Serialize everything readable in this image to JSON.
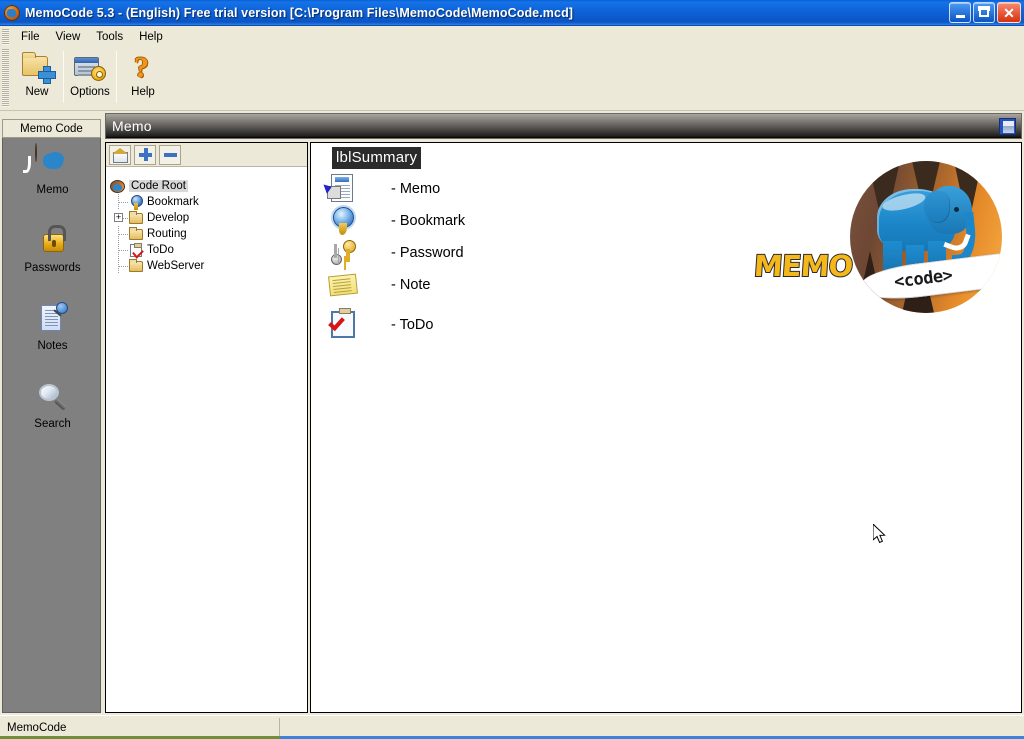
{
  "window": {
    "title": "MemoCode 5.3 - (English) Free trial version  [C:\\Program Files\\MemoCode\\MemoCode.mcd]",
    "app_icon": "memocode-elephant-icon",
    "controls": {
      "minimize": "minimize-button",
      "restore": "restore-button",
      "close": "close-button",
      "close_glyph": "✕"
    }
  },
  "menubar": {
    "items": [
      {
        "label": "File"
      },
      {
        "label": "View"
      },
      {
        "label": "Tools"
      },
      {
        "label": "Help"
      }
    ]
  },
  "toolbar": {
    "buttons": [
      {
        "label": "New",
        "icon": "new-folder-icon"
      },
      {
        "label": "Options",
        "icon": "options-gear-icon"
      },
      {
        "label": "Help",
        "icon": "help-question-icon"
      }
    ]
  },
  "sidebar": {
    "header": "Memo Code",
    "items": [
      {
        "label": "Memo",
        "icon": "memo-elephant-icon"
      },
      {
        "label": "Passwords",
        "icon": "padlock-icon"
      },
      {
        "label": "Notes",
        "icon": "note-pin-icon"
      },
      {
        "label": "Search",
        "icon": "magnifier-icon"
      }
    ]
  },
  "pane": {
    "title": "Memo",
    "save_icon": "save-disk-icon"
  },
  "tree": {
    "toolbar": [
      {
        "name": "home",
        "icon": "home-icon"
      },
      {
        "name": "expand-all",
        "icon": "plus-icon"
      },
      {
        "name": "collapse-all",
        "icon": "minus-icon"
      }
    ],
    "nodes": [
      {
        "label": "Code Root",
        "icon": "code-root-icon",
        "level": 0,
        "selected": true,
        "expander": ""
      },
      {
        "label": "Bookmark",
        "icon": "bookmark-icon",
        "level": 1,
        "selected": false,
        "expander": ""
      },
      {
        "label": "Develop",
        "icon": "folder-icon",
        "level": 1,
        "selected": false,
        "expander": "+"
      },
      {
        "label": "Routing",
        "icon": "folder-icon",
        "level": 1,
        "selected": false,
        "expander": ""
      },
      {
        "label": "ToDo",
        "icon": "todo-clipboard-icon",
        "level": 1,
        "selected": false,
        "expander": ""
      },
      {
        "label": "WebServer",
        "icon": "folder-icon",
        "level": 1,
        "selected": false,
        "expander": ""
      }
    ]
  },
  "content": {
    "summary_label": "lblSummary",
    "items": [
      {
        "text": "- Memo",
        "icon": "memo-document-icon"
      },
      {
        "text": "- Bookmark",
        "icon": "bookmark-rosette-icon"
      },
      {
        "text": "- Password",
        "icon": "keys-icon"
      },
      {
        "text": "- Note",
        "icon": "sticky-note-icon"
      },
      {
        "text": "- ToDo",
        "icon": "todo-clipboard-icon"
      }
    ],
    "logo": {
      "wordmark": "MEMO",
      "ribbon_text": "<code>",
      "alt": "memocode-elephant-logo"
    }
  },
  "statusbar": {
    "text": "MemoCode"
  },
  "colors": {
    "titlebar_blue": "#0e62d8",
    "toolbar_beige": "#ece9d8",
    "sidebar_gray": "#808080",
    "pane_header_dark": "#211f1e",
    "accent_orange": "#f5b81c",
    "elephant_blue": "#1b86c9"
  }
}
